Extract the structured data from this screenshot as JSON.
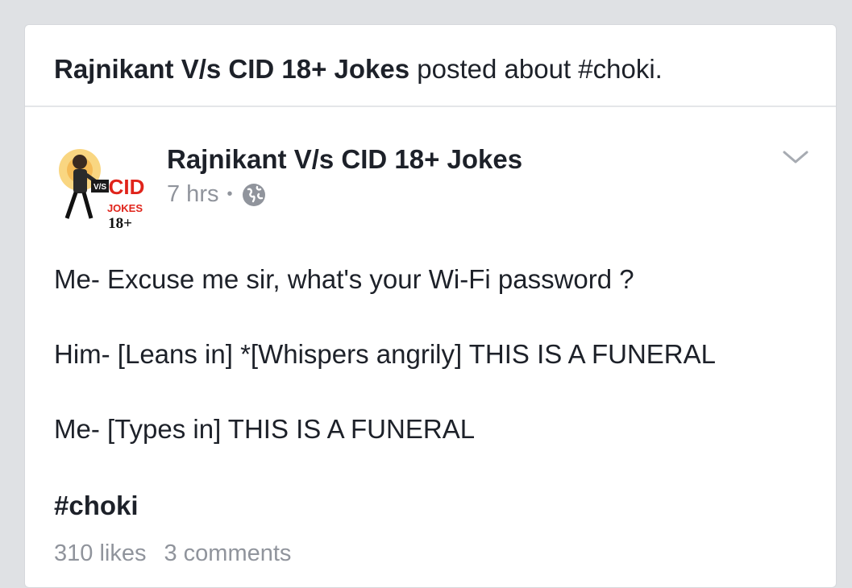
{
  "story": {
    "page_name": "Rajnikant V/s CID 18+ Jokes",
    "action_text": " posted about #choki."
  },
  "post": {
    "author": "Rajnikant V/s CID 18+ Jokes",
    "timestamp": "7 hrs",
    "separator": "•",
    "privacy_icon": "globe-icon",
    "avatar_text": {
      "vs": "V/S",
      "cid": "CID",
      "jokes": "JOKES",
      "age": "18+"
    },
    "body_lines": [
      "Me- Excuse me sir, what's your Wi-Fi password ?",
      "Him- [Leans in] *[Whispers angrily] THIS IS A FUNERAL",
      "Me- [Types in] THIS IS A FUNERAL"
    ],
    "hashtag": "#choki",
    "likes": "310 likes",
    "comments": "3 comments"
  },
  "colors": {
    "background": "#dfe1e4",
    "card": "#ffffff",
    "text_primary": "#1d2129",
    "text_secondary": "#90949c",
    "cid_red": "#e0241b"
  }
}
